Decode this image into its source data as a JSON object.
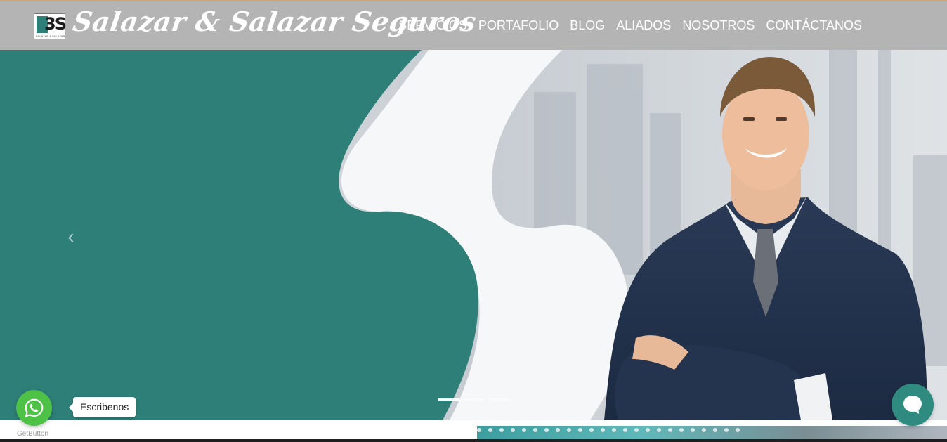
{
  "header": {
    "brand": "Salazar & Salazar Seguros",
    "logo_tiny_text": "SALAZAR & SALAZAR",
    "nav": [
      "SERVICIOS",
      "PORTAFOLIO",
      "BLOG",
      "ALIADOS",
      "NOSOTROS",
      "CONTÁCTANOS"
    ]
  },
  "hero": {
    "prev_icon": "chevron-left-icon",
    "next_icon": "chevron-right-icon",
    "slides_total": 3,
    "active_slide": 1
  },
  "whatsapp": {
    "tooltip": "Escribenos",
    "powered_by": "GetButton",
    "icon": "whatsapp-icon",
    "color": "#4dc247"
  },
  "chat": {
    "icon": "chat-bubble-icon",
    "color": "#2f8a80"
  },
  "colors": {
    "header_bg": "#b4b4b4",
    "teal": "#2f7f79",
    "text_white": "#ffffff"
  }
}
